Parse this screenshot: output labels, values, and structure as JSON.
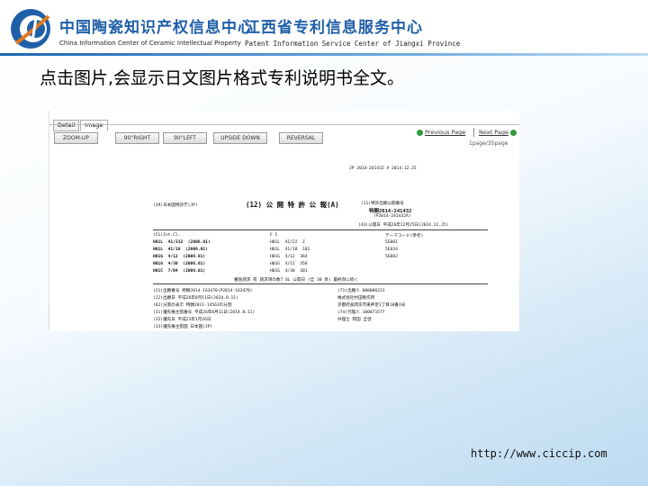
{
  "header": {
    "org_cn_1": "中国陶瓷知识产权信息中心",
    "org_en_1": "China Information Center of Ceramic Intellectual Property",
    "org_cn_2": "江西省专利信息服务中心",
    "org_en_2": "Patent Information Service Center of  Jiangxi  Province",
    "brand_color": "#1f5fa8"
  },
  "caption": "点击图片,会显示日文图片格式专利说明书全文。",
  "viewer": {
    "tabs": [
      {
        "label": "Detail",
        "active": false
      },
      {
        "label": "Image",
        "active": true
      }
    ],
    "toolbar": [
      "ZOOM-UP",
      "90°RIGHT",
      "90°LEFT",
      "UPSIDE DOWN",
      "REVERSAL"
    ],
    "prev_label": "Previous Page",
    "next_label": "Next Page",
    "page_count": "1page/35page"
  },
  "document": {
    "top_id": "JP   2014-241432   A   2014.12.25",
    "office": "(19)日本国特許庁(JP)",
    "pub_type": "(12) 公 開 特 許 公 報(A)",
    "pub_no_label": "(11)特許出願公開番号",
    "pub_no": "特開2014-241432",
    "pub_no_sub": "(P2014-241432A)",
    "pub_date": "(43)公開日   平成26年12月25日(2014.12.25)",
    "ipc_label": "(51)Int.Cl.",
    "fi_label": "F I",
    "theme_label": "テーマコード(参考)",
    "classes": [
      [
        "H01L",
        "41/332",
        "(2006.01)",
        "H01L",
        "41/22",
        "Z",
        "5E001"
      ],
      [
        "H01L",
        "41/18",
        "(2006.01)",
        "H01L",
        "41/18",
        "101",
        "5E034"
      ],
      [
        "H01G",
        "4/12",
        "(2006.01)",
        "H01G",
        "4/12",
        "364",
        "5E082"
      ],
      [
        "H01G",
        "4/30",
        "(2006.01)",
        "H01G",
        "4/12",
        "358",
        ""
      ],
      [
        "H01C",
        "7/04",
        "(2006.01)",
        "H01G",
        "4/30",
        "301",
        ""
      ]
    ],
    "exam_line": "審査請求 有   請求項の数7  OL  公開日   (全 30 頁)   最終頁に続く",
    "biblio_left": [
      "(21)出願番号      特願2014-163470(P2014-163470)",
      "(22)出願日        平成26年8月11日(2014.8.11)",
      "(62)分割の表示    特願2011-14563の分割",
      "(31)優先権主張番号 平成26年8月11日(2014.8.11)",
      "(32)優先日        平成23年1月26日",
      "(33)優先権主張国  日本国(JP)"
    ],
    "biblio_right": [
      "(71)出願人   000006231",
      "             株式会社村田製作所",
      "             京都府長岡京市東神足1丁目10番1号",
      "(74)代理人   100071577",
      "             弁理士  岡田  全啓"
    ]
  },
  "footer_url": "http://www.ciccip.com"
}
